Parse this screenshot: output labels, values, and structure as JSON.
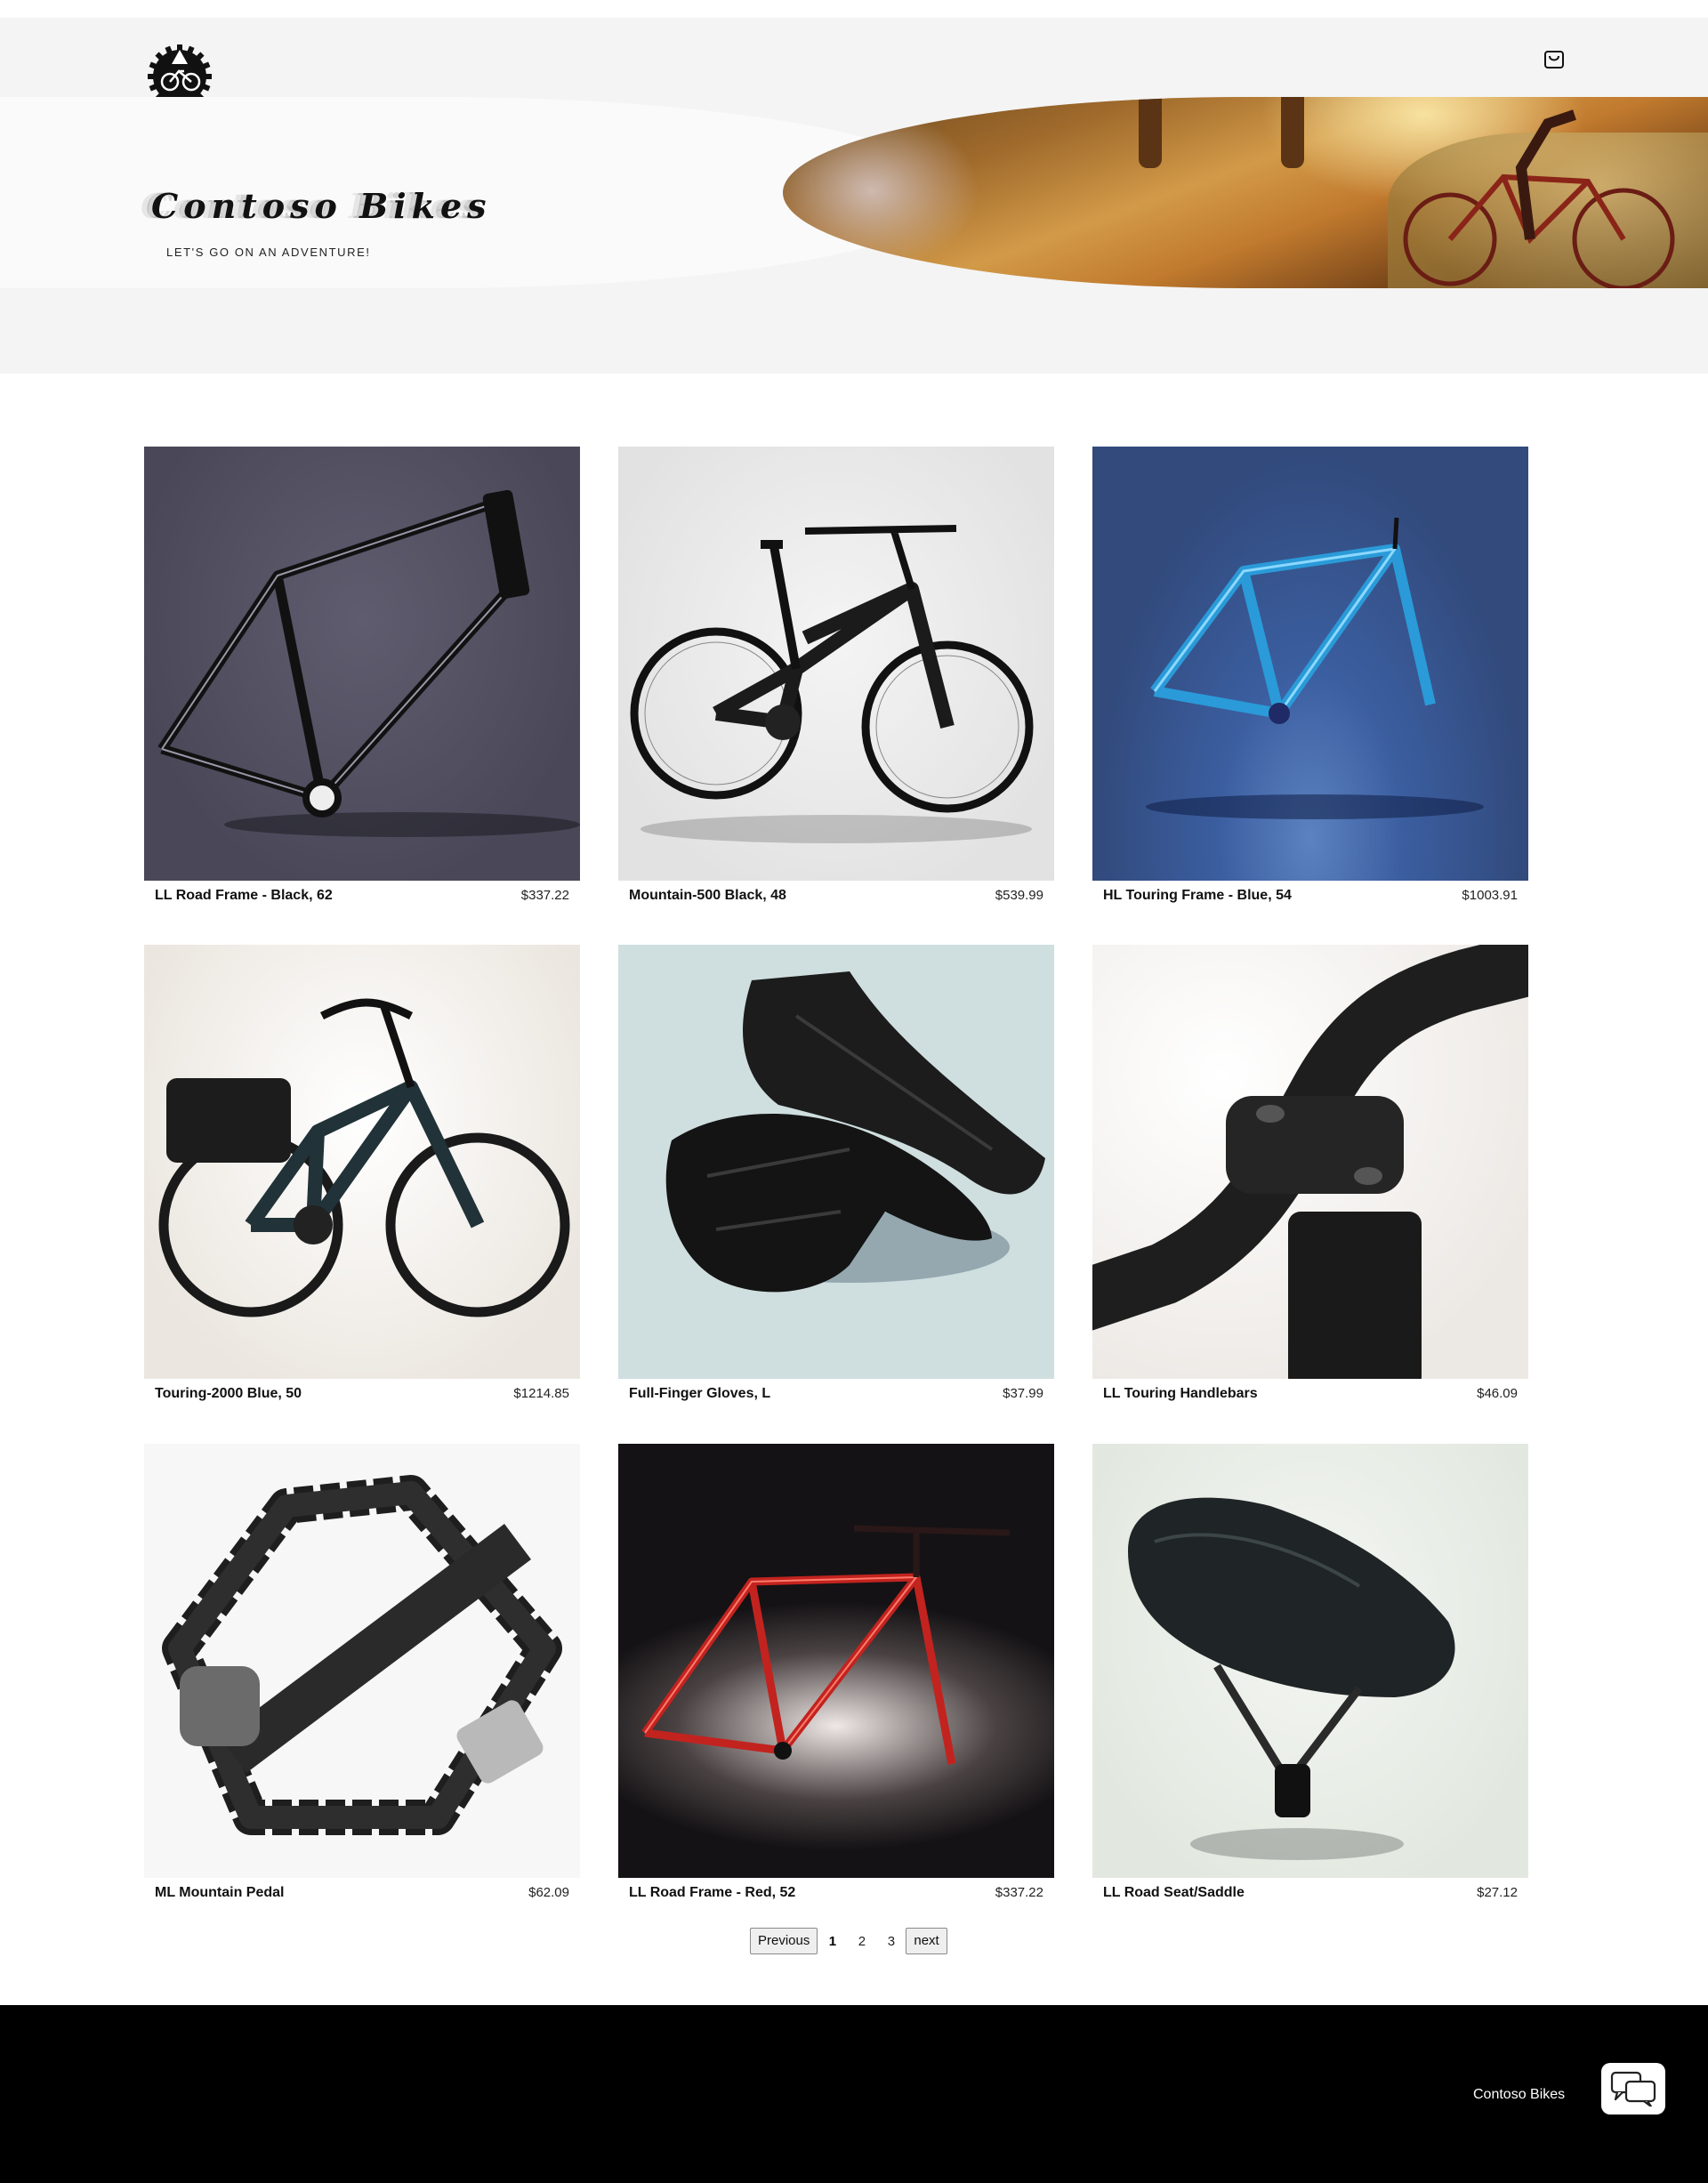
{
  "header": {
    "logo_alt": "logo",
    "cart_icon": "shopping-bag-icon",
    "brand": "Contoso Bikes",
    "tagline": "LET'S GO ON AN ADVENTURE!"
  },
  "products": [
    {
      "name": "LL Road Frame - Black, 62",
      "price": "$337.22"
    },
    {
      "name": "Mountain-500 Black, 48",
      "price": "$539.99"
    },
    {
      "name": "HL Touring Frame - Blue, 54",
      "price": "$1003.91"
    },
    {
      "name": "Touring-2000 Blue, 50",
      "price": "$1214.85"
    },
    {
      "name": "Full-Finger Gloves, L",
      "price": "$37.99"
    },
    {
      "name": "LL Touring Handlebars",
      "price": "$46.09"
    },
    {
      "name": "ML Mountain Pedal",
      "price": "$62.09"
    },
    {
      "name": "LL Road Frame - Red, 52",
      "price": "$337.22"
    },
    {
      "name": "LL Road Seat/Saddle",
      "price": "$27.12"
    }
  ],
  "pagination": {
    "previous": "Previous",
    "pages": [
      "1",
      "2",
      "3"
    ],
    "current": "1",
    "next": "next"
  },
  "footer": {
    "company": "Contoso Bikes",
    "chat_icon": "chat-bubbles-icon"
  },
  "colors": {
    "header_bg": "#f4f4f4",
    "footer_bg": "#000000",
    "accent_blue": "#2a9ad8",
    "accent_red": "#c2231f"
  }
}
